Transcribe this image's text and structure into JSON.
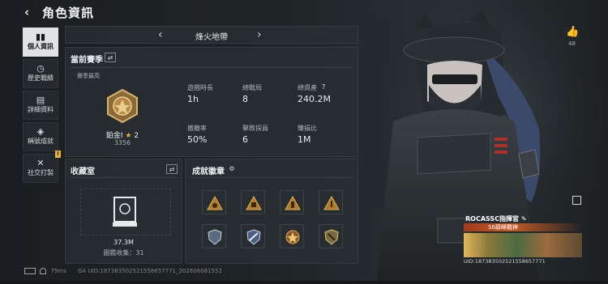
{
  "header": {
    "back_icon": "‹",
    "title": "角色資訊"
  },
  "sidebar": {
    "items": [
      {
        "icon": "▮▮",
        "label": "個人資訊",
        "active": true
      },
      {
        "icon": "◷",
        "label": "歷史戰績"
      },
      {
        "icon": "▤",
        "label": "詳細資料"
      },
      {
        "icon": "◈",
        "label": "稱號成就"
      },
      {
        "icon": "✕",
        "label": "社交打製",
        "badge": "!"
      }
    ]
  },
  "mapbar": {
    "prev_icon": "‹",
    "map_name": "烽火地帶",
    "next_icon": "›"
  },
  "season": {
    "title": "當前賽季",
    "swap_icon": "⇄",
    "peak_label": "賽季最高",
    "rank_name": "鉑金Ⅰ",
    "rank_star_icon": "★",
    "rank_stars": "2",
    "rank_points": "3356",
    "stats": [
      {
        "label": "遊戲時長",
        "value": "1h"
      },
      {
        "label": "總戰局",
        "value": "8"
      },
      {
        "label": "總資產",
        "value": "240.2M",
        "help": "?"
      },
      {
        "label": "撤離率",
        "value": "50%"
      },
      {
        "label": "擊敗探員",
        "value": "6"
      },
      {
        "label": "賺損比",
        "value": "1M"
      }
    ]
  },
  "vault": {
    "title": "收藏室",
    "swap_icon": "⇄",
    "value": "37.3M",
    "collection_label": "圖鑑收集：",
    "collection_count": "31"
  },
  "achievements": {
    "title": "成就徽章",
    "settings_icon": "⚙"
  },
  "profile": {
    "likes": "48",
    "name": "ROCASSC指揮官",
    "edit_icon": "✎",
    "rank_title": "S6巔峰戰神",
    "uid": "UID:187383502521558657771"
  },
  "footer": {
    "ping": "79ms",
    "uid": "GA UID:187383502521558657771_202606081552"
  },
  "colors": {
    "accent_active": "#dfe3e5",
    "badge": "#e8b43a",
    "gold": "#c9a25a"
  }
}
